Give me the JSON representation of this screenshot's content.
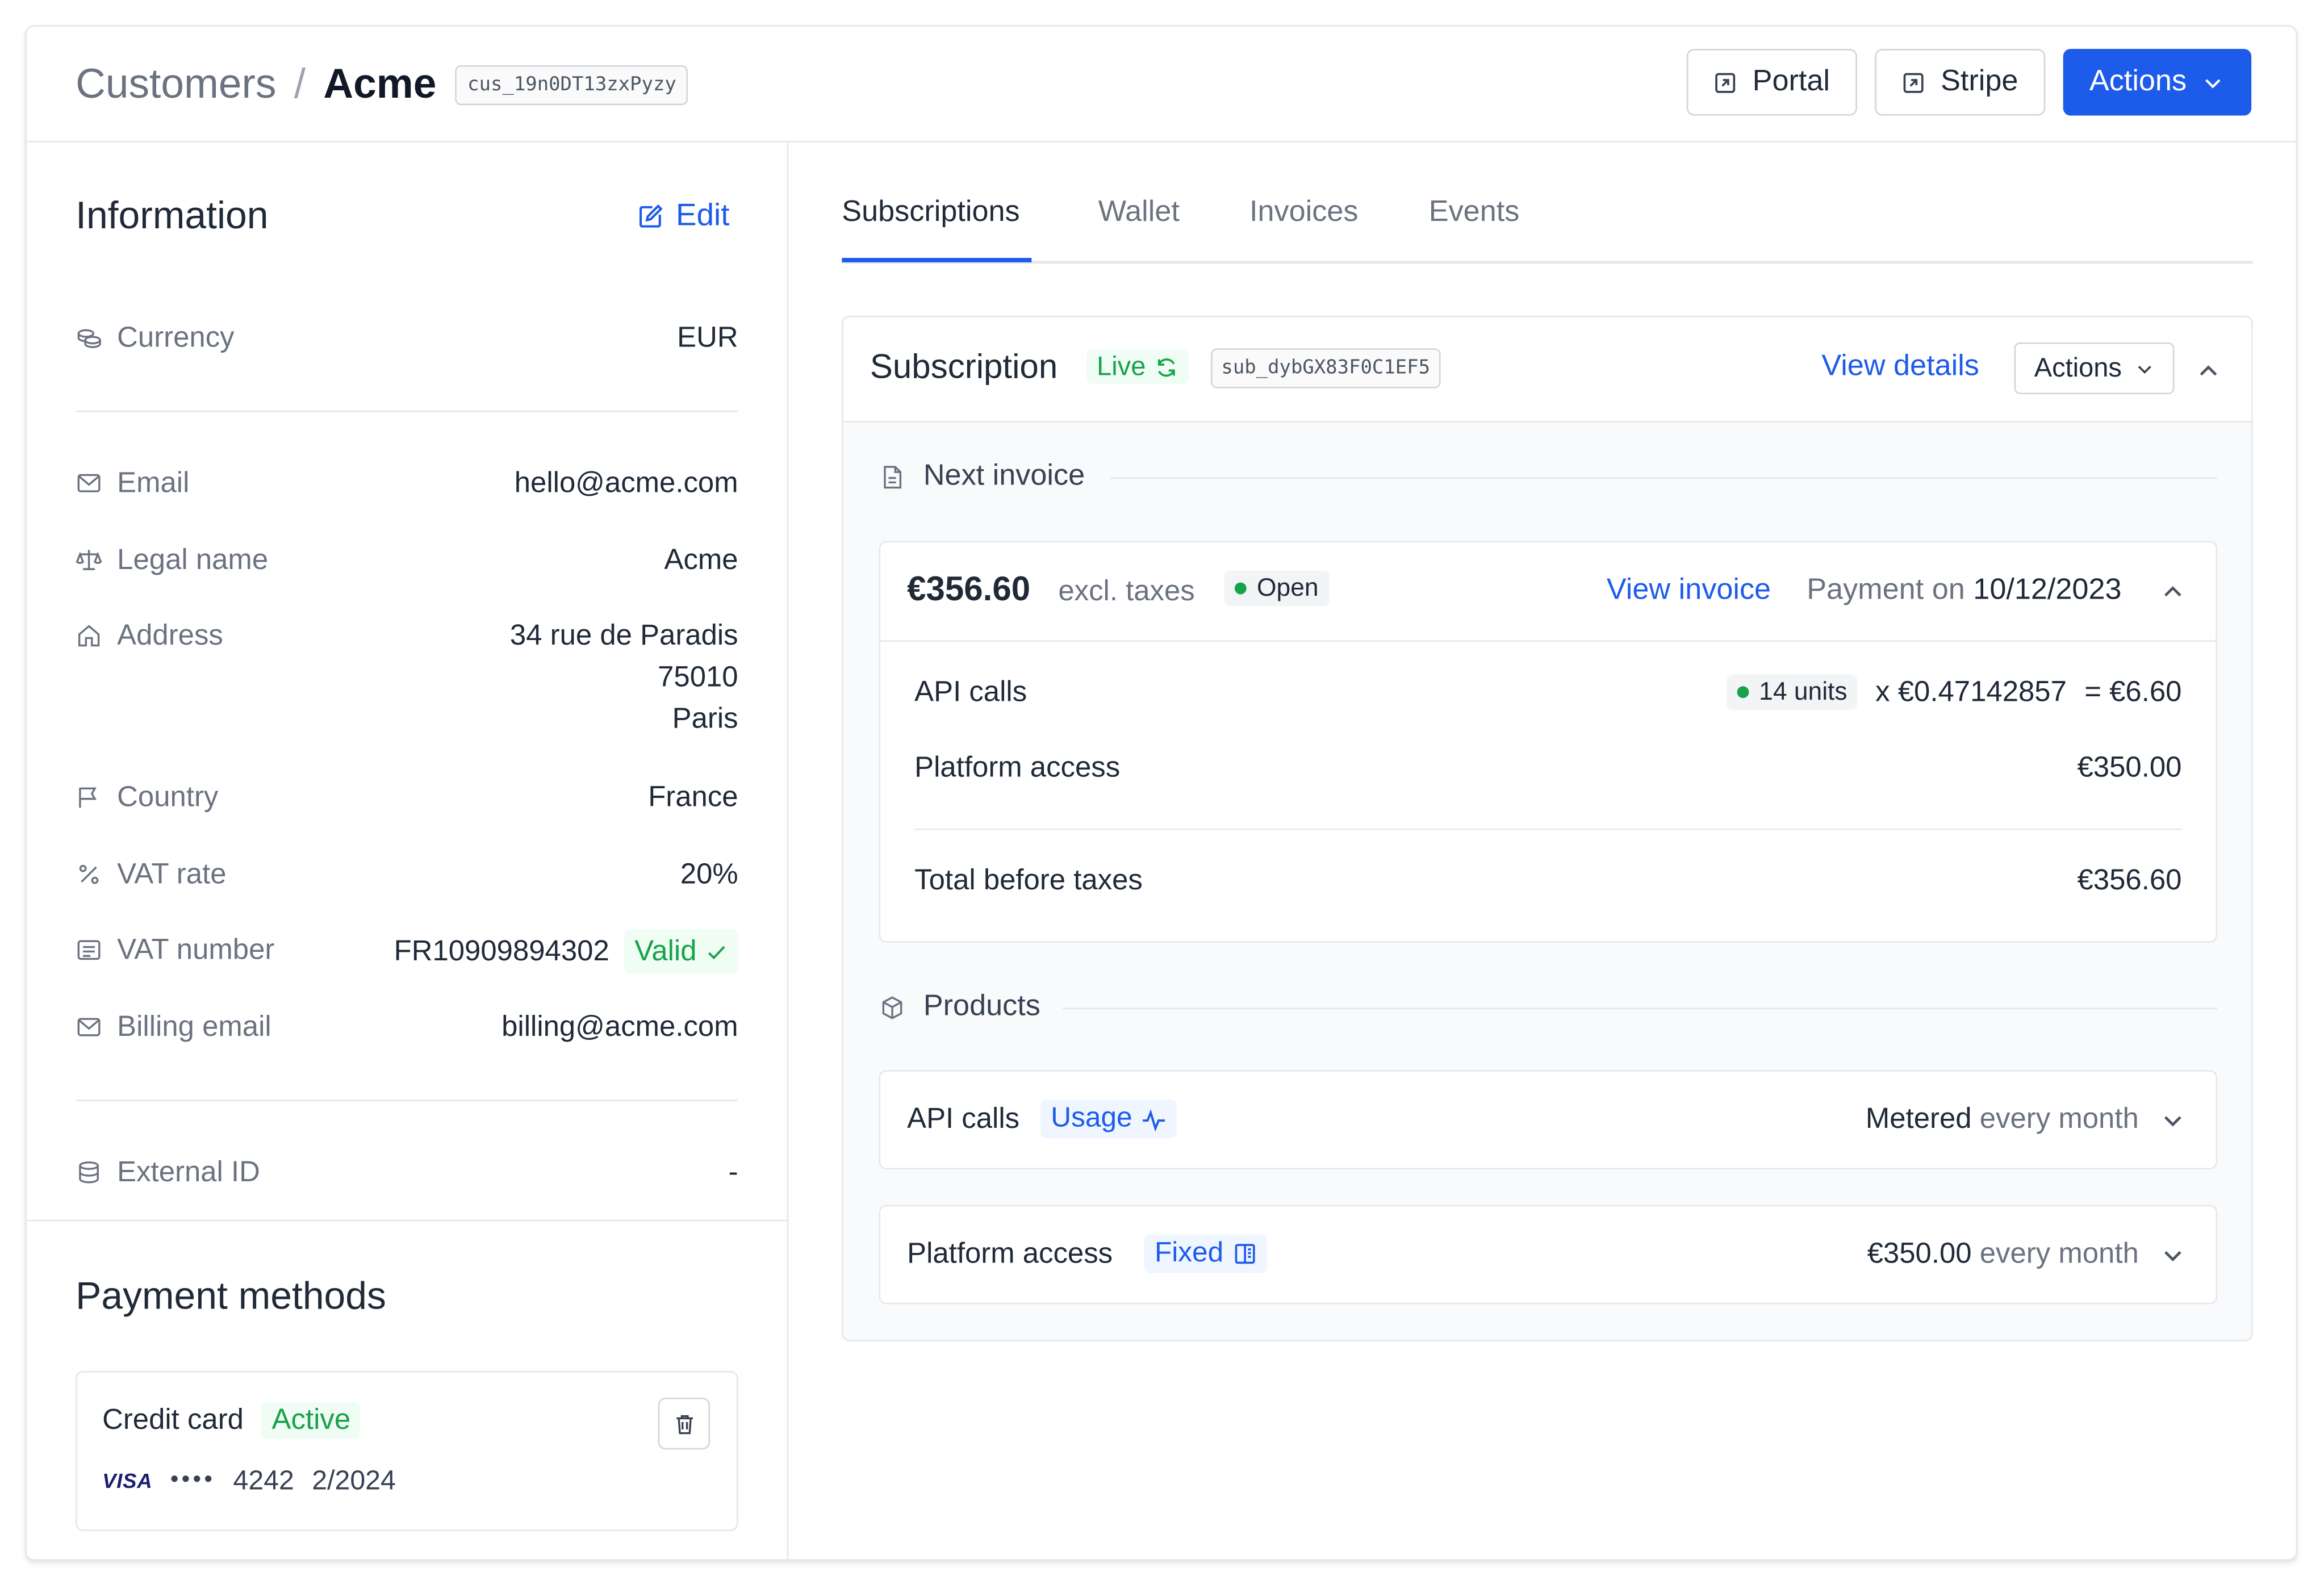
{
  "header": {
    "breadcrumb_root": "Customers",
    "breadcrumb_separator": "/",
    "customer_name": "Acme",
    "customer_id": "cus_19n0DT13zxPyzy",
    "portal_label": "Portal",
    "stripe_label": "Stripe",
    "actions_label": "Actions"
  },
  "information": {
    "title": "Information",
    "edit_label": "Edit",
    "currency": {
      "label": "Currency",
      "value": "EUR"
    },
    "email": {
      "label": "Email",
      "value": "hello@acme.com"
    },
    "legal_name": {
      "label": "Legal name",
      "value": "Acme"
    },
    "address": {
      "label": "Address",
      "line1": "34 rue de Paradis",
      "line2": "75010",
      "line3": "Paris"
    },
    "country": {
      "label": "Country",
      "value": "France"
    },
    "vat_rate": {
      "label": "VAT rate",
      "value": "20%"
    },
    "vat_number": {
      "label": "VAT number",
      "value": "FR10909894302",
      "status": "Valid"
    },
    "billing_email": {
      "label": "Billing email",
      "value": "billing@acme.com"
    },
    "external_id": {
      "label": "External ID",
      "value": "-"
    }
  },
  "payment_methods": {
    "title": "Payment methods",
    "card": {
      "type": "Credit card",
      "status": "Active",
      "brand": "VISA",
      "dots": "••••",
      "last4": "4242",
      "expiry": "2/2024"
    }
  },
  "tabs": [
    {
      "label": "Subscriptions",
      "active": true
    },
    {
      "label": "Wallet",
      "active": false
    },
    {
      "label": "Invoices",
      "active": false
    },
    {
      "label": "Events",
      "active": false
    }
  ],
  "subscription": {
    "title": "Subscription",
    "status": "Live",
    "id": "sub_dybGX83F0C1EF5",
    "view_details_label": "View details",
    "actions_label": "Actions",
    "next_invoice": {
      "section_label": "Next invoice",
      "amount": "€356.60",
      "amount_suffix": "excl. taxes",
      "status": "Open",
      "view_invoice_label": "View invoice",
      "payment_prefix": "Payment on",
      "payment_date": "10/12/2023",
      "lines": [
        {
          "name": "API calls",
          "units": "14 units",
          "unit_price": "x €0.47142857",
          "total": "= €6.60"
        },
        {
          "name": "Platform access",
          "total": "€350.00"
        }
      ],
      "total_label": "Total before taxes",
      "total_value": "€356.60"
    },
    "products": {
      "section_label": "Products",
      "items": [
        {
          "name": "API calls",
          "tag": "Usage",
          "price_main": "Metered",
          "price_suffix": "every month"
        },
        {
          "name": "Platform access",
          "tag": "Fixed",
          "price_main": "€350.00",
          "price_suffix": "every month"
        }
      ]
    }
  },
  "colors": {
    "accent": "#1d5bea",
    "success": "#16a34a",
    "border": "#e5e7eb",
    "muted_text": "#6b7280"
  }
}
